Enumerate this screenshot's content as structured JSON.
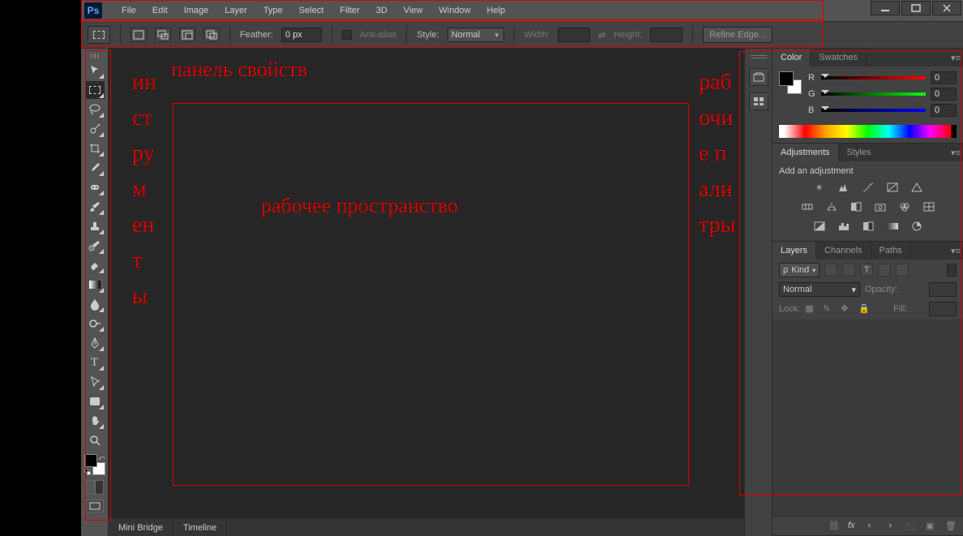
{
  "menu": {
    "items": [
      "File",
      "Edit",
      "Image",
      "Layer",
      "Type",
      "Select",
      "Filter",
      "3D",
      "View",
      "Window",
      "Help"
    ]
  },
  "options": {
    "feather_label": "Feather:",
    "feather_value": "0 px",
    "antialias": "Anti-alias",
    "style_label": "Style:",
    "style_value": "Normal",
    "width_label": "Width:",
    "height_label": "Height:",
    "refine": "Refine Edge..."
  },
  "bottom": {
    "tabs": [
      "Mini Bridge",
      "Timeline"
    ]
  },
  "color_panel": {
    "tabs": [
      "Color",
      "Swatches"
    ],
    "channels": [
      {
        "label": "R",
        "value": "0"
      },
      {
        "label": "G",
        "value": "0"
      },
      {
        "label": "B",
        "value": "0"
      }
    ]
  },
  "adjustments_panel": {
    "tabs": [
      "Adjustments",
      "Styles"
    ],
    "title": "Add an adjustment"
  },
  "layers_panel": {
    "tabs": [
      "Layers",
      "Channels",
      "Paths"
    ],
    "kind": "Kind",
    "blend": "Normal",
    "opacity_label": "Opacity:",
    "lock_label": "Lock:",
    "fill_label": "Fill:"
  },
  "annotations": {
    "properties": "панель свойств",
    "tools": "инструменты",
    "workspace": "рабочее пространство",
    "palettes": "рабочие палитры"
  }
}
